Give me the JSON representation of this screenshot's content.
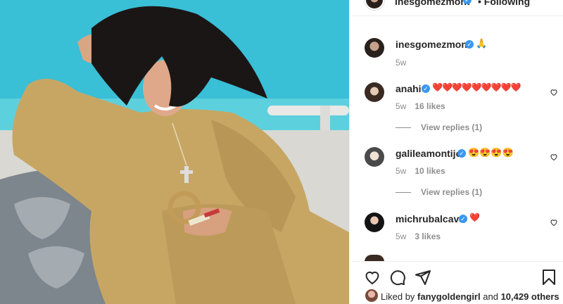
{
  "post": {
    "author": "inesgomezmont",
    "follow_state": "Following",
    "caption_emoji": "🙏",
    "caption_age": "5w"
  },
  "comments": [
    {
      "user": "anahi",
      "verified": true,
      "text": "❤️❤️❤️❤️❤️❤️❤️❤️❤️",
      "age": "5w",
      "likes": "16 likes",
      "replies": "View replies (1)"
    },
    {
      "user": "galileamontijo",
      "verified": true,
      "text": "😍😍😍😍",
      "age": "5w",
      "likes": "10 likes",
      "replies": "View replies (1)"
    },
    {
      "user": "michrubalcava",
      "verified": true,
      "text": "❤️",
      "age": "5w",
      "likes": "3 likes"
    }
  ],
  "footer": {
    "liked_by_prefix": "Liked by",
    "liked_by_user": "fanygoldengirl",
    "liked_by_and": "and",
    "liked_by_count": "10,429 others"
  },
  "icons": {
    "like": "heart-icon",
    "comment": "comment-icon",
    "share": "share-icon",
    "save": "bookmark-icon",
    "more": "more-options-icon"
  },
  "colors": {
    "verified": "#3897f0",
    "heart": "#ed4956",
    "muted": "#8e8e8e",
    "text": "#262626"
  }
}
